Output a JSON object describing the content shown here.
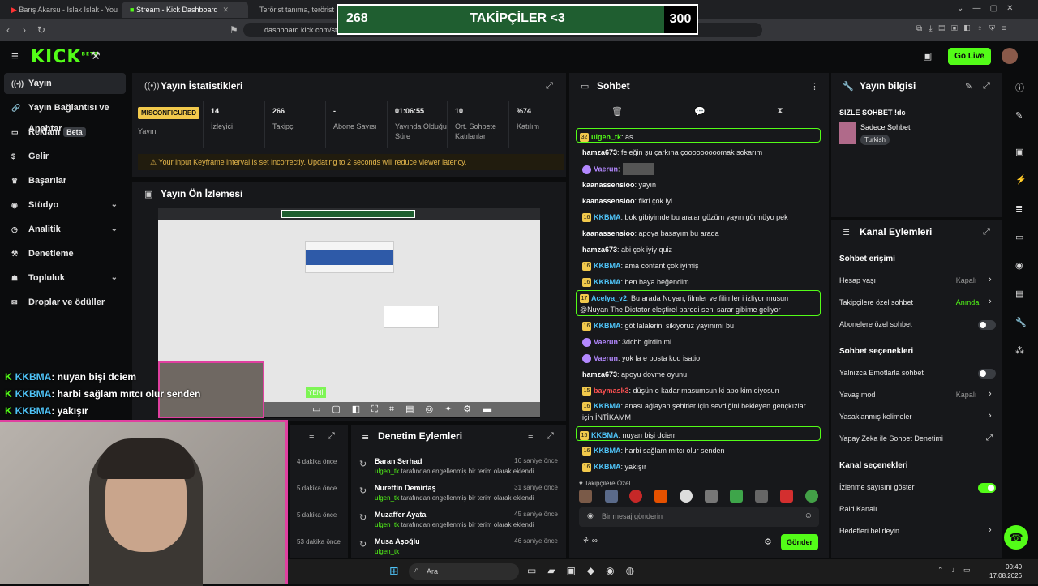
{
  "browser": {
    "tabs": [
      {
        "label": "Barış Akarsu - Islak Islak - YouTube"
      },
      {
        "label": "Stream - Kick Dashboard"
      },
      {
        "label": "Terörist tanıma, terörist t..."
      }
    ],
    "url": "dashboard.kick.com/st..."
  },
  "overlay": {
    "left": "268",
    "title": "TAKİPÇİLER <3",
    "right": "300"
  },
  "app": {
    "logo": "KICK",
    "logo_sup": "BETA",
    "go_live": "Go Live"
  },
  "sidebar": {
    "items": [
      {
        "label": "Yayın",
        "icon": "broadcast-icon"
      },
      {
        "label": "Yayın Bağlantısı ve Anahtar",
        "icon": "link-icon"
      },
      {
        "label": "Reklam",
        "icon": "ad-icon",
        "badge": "Beta"
      },
      {
        "label": "Gelir",
        "icon": "money-icon"
      },
      {
        "label": "Başarılar",
        "icon": "trophy-icon"
      },
      {
        "label": "Stüdyo",
        "icon": "studio-icon"
      },
      {
        "label": "Analitik",
        "icon": "chart-icon"
      },
      {
        "label": "Denetleme",
        "icon": "hammer-icon"
      },
      {
        "label": "Topluluk",
        "icon": "people-icon"
      },
      {
        "label": "Droplar ve ödüller",
        "icon": "gift-icon"
      }
    ]
  },
  "stats": {
    "title": "Yayın İstatistikleri",
    "status": "MISCONFIGURED",
    "status_label": "Yayın",
    "items": [
      {
        "value": "14",
        "label": "İzleyici"
      },
      {
        "value": "266",
        "label": "Takipçi"
      },
      {
        "value": "-",
        "label": "Abone Sayısı"
      },
      {
        "value": "01:06:55",
        "label": "Yayında Olduğu Süre"
      },
      {
        "value": "10",
        "label": "Ort. Sohbete Katılanlar"
      },
      {
        "value": "%74",
        "label": "Katılım"
      }
    ],
    "warning": "Your input Keyframe interval is set incorrectly. Updating to 2 seconds will reduce viewer latency."
  },
  "preview": {
    "title": "Yayın Ön İzlemesi",
    "new_badge": "YENİ"
  },
  "overlay_chat": [
    {
      "user": "KKBMA",
      "text": ": nuyan bişi dciem"
    },
    {
      "user": "KKBMA",
      "text": ": harbi sağlam mıtcı olur senden"
    },
    {
      "user": "KKBMA",
      "text": ": yakışır"
    }
  ],
  "recent": {
    "times": [
      "4 dakika önce",
      "5 dakika önce",
      "5 dakika önce",
      "53 dakika önce"
    ]
  },
  "audit": {
    "title": "Denetim Eylemleri",
    "items": [
      {
        "name": "Baran Serhad",
        "by": "ulgen_tk",
        "desc": "tarafından engellenmiş bir terim olarak eklendi",
        "time": "16 saniye önce"
      },
      {
        "name": "Nurettin Demirtaş",
        "by": "ulgen_tk",
        "desc": "tarafından engellenmiş bir terim olarak eklendi",
        "time": "31 saniye önce"
      },
      {
        "name": "Muzaffer Ayata",
        "by": "ulgen_tk",
        "desc": "tarafından engellenmiş bir terim olarak eklendi",
        "time": "45 saniye önce"
      },
      {
        "name": "Musa Aşoğlu",
        "by": "ulgen_tk",
        "desc": "",
        "time": "46 saniye önce"
      }
    ]
  },
  "chat": {
    "title": "Sohbet",
    "messages": [
      {
        "badge": "32",
        "user": "ulgen_tk",
        "color": "#53fc18",
        "text": ": as",
        "hl": true
      },
      {
        "badge": "",
        "user": "hamza673",
        "color": "#ffffff",
        "text": ": feleğin şu çarkına çooooooooomak sokarım"
      },
      {
        "badge": "",
        "user": "Vaerun",
        "color": "#b388ff",
        "text": ":"
      },
      {
        "badge": "",
        "user": "kaanassensioo",
        "color": "#ffffff",
        "text": ": yayın"
      },
      {
        "badge": "",
        "user": "kaanassensioo",
        "color": "#ffffff",
        "text": ": fikri çok iyi"
      },
      {
        "badge": "16",
        "user": "KKBMA",
        "color": "#4fc3f7",
        "text": ": bok gibiyimde bu aralar gözüm yayın görmüyo pek"
      },
      {
        "badge": "",
        "user": "kaanassensioo",
        "color": "#ffffff",
        "text": ": apoya basayım bu arada"
      },
      {
        "badge": "",
        "user": "hamza673",
        "color": "#ffffff",
        "text": ": abi çok iyiy quiz"
      },
      {
        "badge": "16",
        "user": "KKBMA",
        "color": "#4fc3f7",
        "text": ": ama contant çok iyimiş"
      },
      {
        "badge": "16",
        "user": "KKBMA",
        "color": "#4fc3f7",
        "text": ": ben baya beğendim"
      },
      {
        "badge": "17",
        "user": "Acelya_v2",
        "color": "#4fc3f7",
        "text": ": Bu arada Nuyan, filmler ve filimler i izliyor musun",
        "line2": "@Nuyan The Dictator eleştirel parodi seni sarar gibime geliyor",
        "hl": true
      },
      {
        "badge": "16",
        "user": "KKBMA",
        "color": "#4fc3f7",
        "text": ": göt lalalerini sikiyoruz yayınımı bu"
      },
      {
        "badge": "",
        "user": "Vaerun",
        "color": "#b388ff",
        "text": ": 3dcbh girdin mi"
      },
      {
        "badge": "",
        "user": "Vaerun",
        "color": "#b388ff",
        "text": ": yok la e posta kod isatio"
      },
      {
        "badge": "",
        "user": "hamza673",
        "color": "#ffffff",
        "text": ": apoyu dovme oyunu"
      },
      {
        "badge": "15",
        "user": "baymask3",
        "color": "#ff5252",
        "text": ": düşün o kadar masumsun ki apo kim diyosun"
      },
      {
        "badge": "16",
        "user": "KKBMA",
        "color": "#4fc3f7",
        "text": ": anası ağlayan şehitler için sevdiğini bekleyen gençkızlar",
        "line2": "için İNTİKAMM"
      },
      {
        "badge": "16",
        "user": "KKBMA",
        "color": "#4fc3f7",
        "text": ": nuyan bişi dciem",
        "hl": true
      },
      {
        "badge": "16",
        "user": "KKBMA",
        "color": "#4fc3f7",
        "text": ": harbi sağlam mıtcı olur senden"
      },
      {
        "badge": "16",
        "user": "KKBMA",
        "color": "#4fc3f7",
        "text": ": yakışır"
      }
    ],
    "emote_label": "♥ Takipçilere Özel",
    "input_placeholder": "Bir mesaj gönderin",
    "send": "Gönder"
  },
  "stream_info": {
    "title": "Yayın bilgisi",
    "stream_title": "SİZLE SOHBET !dc",
    "category": "Sadece Sohbet",
    "tag": "Turkish"
  },
  "channel_actions": {
    "title": "Kanal Eylemleri",
    "sections": [
      {
        "heading": "Sohbet erişimi",
        "rows": [
          {
            "label": "Hesap yaşı",
            "value": "Kapalı",
            "kind": "chev"
          },
          {
            "label": "Takipçilere özel sohbet",
            "value": "Anında",
            "kind": "chev",
            "accent": true
          },
          {
            "label": "Abonelere özel sohbet",
            "value": "",
            "kind": "toggle",
            "on": false
          }
        ]
      },
      {
        "heading": "Sohbet seçenekleri",
        "rows": [
          {
            "label": "Yalnızca Emotlarla sohbet",
            "value": "",
            "kind": "toggle",
            "on": false
          },
          {
            "label": "Yavaş mod",
            "value": "Kapalı",
            "kind": "chev"
          },
          {
            "label": "Yasaklanmış kelimeler",
            "value": "",
            "kind": "chev"
          },
          {
            "label": "Yapay Zeka ile Sohbet Denetimi",
            "value": "",
            "kind": "ext"
          }
        ]
      },
      {
        "heading": "Kanal seçenekleri",
        "rows": [
          {
            "label": "İzlenme sayısını göster",
            "value": "",
            "kind": "toggle",
            "on": true
          },
          {
            "label": "Raid Kanalı",
            "value": "",
            "kind": "none"
          },
          {
            "label": "Hedefleri belirleyin",
            "value": "",
            "kind": "chev"
          }
        ]
      }
    ]
  },
  "taskbar": {
    "search": "Ara",
    "time": "00:40",
    "date": "17.08.2026"
  },
  "colors": {
    "accent": "#53fc18",
    "panel": "#17181b",
    "bg": "#0b0c0d",
    "warning": "#e6b84c"
  }
}
